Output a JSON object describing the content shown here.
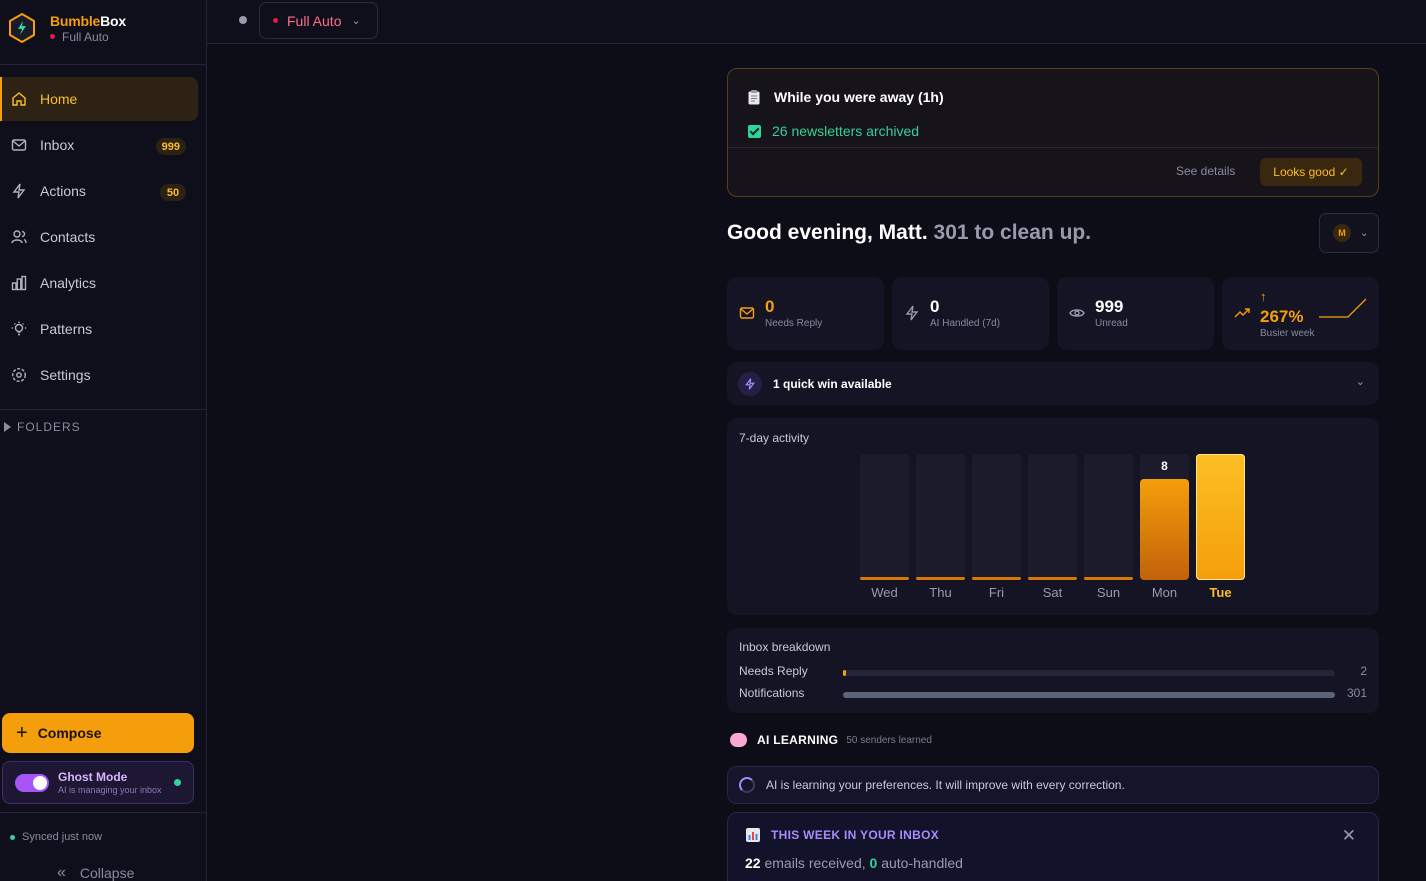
{
  "brand": {
    "name_part1": "Bumble",
    "name_part2": "Box",
    "mode": "Full Auto"
  },
  "nav": {
    "home": "Home",
    "inbox": "Inbox",
    "inbox_badge": "999",
    "actions": "Actions",
    "actions_badge": "50",
    "contacts": "Contacts",
    "analytics": "Analytics",
    "patterns": "Patterns",
    "settings": "Settings"
  },
  "folders_label": "FOLDERS",
  "compose_label": "Compose",
  "ghost": {
    "title": "Ghost Mode",
    "subtitle": "AI is managing your inbox",
    "enabled": true
  },
  "sync_status": "Synced just now",
  "collapse_label": "Collapse",
  "topbar": {
    "mode_label": "Full Auto"
  },
  "away": {
    "title": "While you were away (1h)",
    "item": "26 newsletters archived",
    "see_details": "See details",
    "looks_good": "Looks good ✓"
  },
  "greeting": {
    "hello": "Good evening, Matt.",
    "rest": "301 to clean up."
  },
  "avatar_initial": "M",
  "stats": [
    {
      "value": "0",
      "label": "Needs Reply",
      "color": "#f59e0b",
      "icon": "mail-icon"
    },
    {
      "value": "0",
      "label": "AI Handled (7d)",
      "color": "#ffffff",
      "icon": "bolt-icon"
    },
    {
      "value": "999",
      "label": "Unread",
      "color": "#ffffff",
      "icon": "eye-icon"
    },
    {
      "value": "267%",
      "label": "Busier week",
      "color": "#f59e0b",
      "icon": "trending-up-icon"
    }
  ],
  "quick_win": "1 quick win available",
  "activity": {
    "title": "7-day activity",
    "days": [
      "Wed",
      "Thu",
      "Fri",
      "Sat",
      "Sun",
      "Mon",
      "Tue"
    ],
    "values": [
      0,
      0,
      0,
      0,
      0,
      8,
      10
    ],
    "labels": [
      "",
      "",
      "",
      "",
      "",
      "8",
      ""
    ]
  },
  "breakdown": {
    "title": "Inbox breakdown",
    "rows": [
      {
        "label": "Needs Reply",
        "value": "2",
        "fraction": 0.0066,
        "color": "#f59e0b"
      },
      {
        "label": "Notifications",
        "value": "301",
        "fraction": 1.0,
        "color": "#5b6478"
      }
    ]
  },
  "ai_learning": {
    "title": "AI LEARNING",
    "subtitle": "50 senders learned",
    "message": "AI is learning your preferences. It will improve with every correction."
  },
  "week": {
    "title": "THIS WEEK IN YOUR INBOX",
    "received": "22",
    "received_text": " emails received, ",
    "handled": "0",
    "handled_text": " auto-handled"
  },
  "colors": {
    "accent": "#f59e0b",
    "ghost": "#a855f7",
    "success": "#34d399",
    "alert": "#e11d48"
  }
}
